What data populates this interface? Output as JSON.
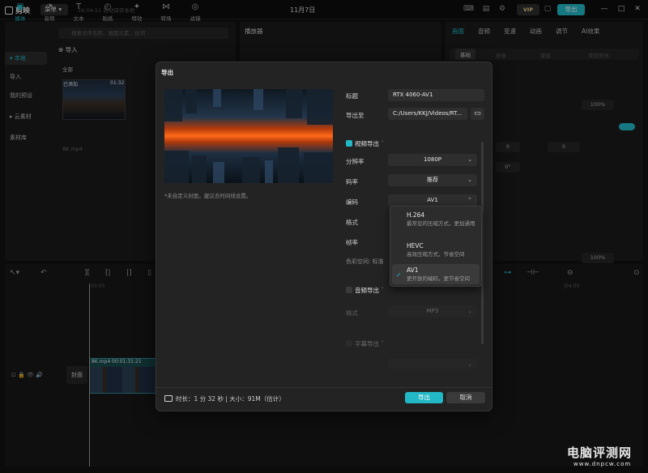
{
  "app": {
    "name": "剪映",
    "menu_label": "菜单",
    "autosave": "16:04:11 自动保存本地",
    "date": "11月7日",
    "vip_label": "VIP",
    "export_label": "导出"
  },
  "toolbar": {
    "tools": [
      {
        "label": "媒体",
        "icon": "media-icon"
      },
      {
        "label": "音频",
        "icon": "audio-icon"
      },
      {
        "label": "文本",
        "icon": "text-icon"
      },
      {
        "label": "贴纸",
        "icon": "sticker-icon"
      },
      {
        "label": "特效",
        "icon": "effects-icon"
      },
      {
        "label": "转场",
        "icon": "transition-icon"
      },
      {
        "label": "滤镜",
        "icon": "filter-icon"
      }
    ]
  },
  "media_panel": {
    "side": [
      "本地",
      "导入",
      "我的预设",
      "云素材",
      "素材库"
    ],
    "search_placeholder": "搜索文件名称、画面元素、台词",
    "import_label": "导入",
    "all_label": "全部",
    "thumb_badge": "已添加",
    "thumb_duration": "01:32",
    "thumb_name": "8K.mp4"
  },
  "player": {
    "title": "播放器"
  },
  "props": {
    "tabs": [
      "画面",
      "音频",
      "变速",
      "动画",
      "调节",
      "AI效果"
    ],
    "subtabs": [
      "基础",
      "抠像",
      "蒙版",
      "美颜美体"
    ],
    "values": [
      "100%",
      "0",
      "0",
      "0°",
      "100%"
    ]
  },
  "timeline": {
    "ruler": [
      "00:00",
      "|04:00"
    ],
    "clip_label": "8K.mp4  00:01:31:21",
    "cover_label": "封面"
  },
  "dialog": {
    "title": "导出",
    "cover_hint": "*未自定义封面，建议去时间线设置。",
    "fields": {
      "title_label": "标题",
      "title_value": "RTX 4060-AV1",
      "export_to_label": "导出至",
      "export_to_value": "C:/Users/KKJ/Videos/RT...",
      "video_section": "视频导出",
      "resolution_label": "分辨率",
      "resolution_value": "1080P",
      "bitrate_label": "码率",
      "bitrate_value": "推荐",
      "codec_label": "编码",
      "codec_value": "AV1",
      "format_label": "格式",
      "framerate_label": "帧率",
      "colorspace_label": "色彩空间: 标准",
      "audio_section": "音频导出",
      "audio_format_label": "格式",
      "audio_format_value": "MP3",
      "subtitle_section": "字幕导出"
    },
    "codec_options": [
      {
        "name": "H.264",
        "desc": "最常见的压缩方式，更加通用"
      },
      {
        "name": "HEVC",
        "desc": "高效压缩方式，节省空间"
      },
      {
        "name": "AV1",
        "desc": "更开放的编码，更节省空间"
      }
    ],
    "footer": {
      "info": "时长：1 分 32 秒 | 大小：91M（估计）",
      "export_btn": "导出",
      "cancel_btn": "取消"
    }
  },
  "watermark": {
    "text": "电脑评测网",
    "url": "www.dnpcw.com"
  },
  "colors": {
    "accent": "#22b8c6",
    "bg": "#121212",
    "panel": "#1b1b1b",
    "dialog": "#232323"
  }
}
